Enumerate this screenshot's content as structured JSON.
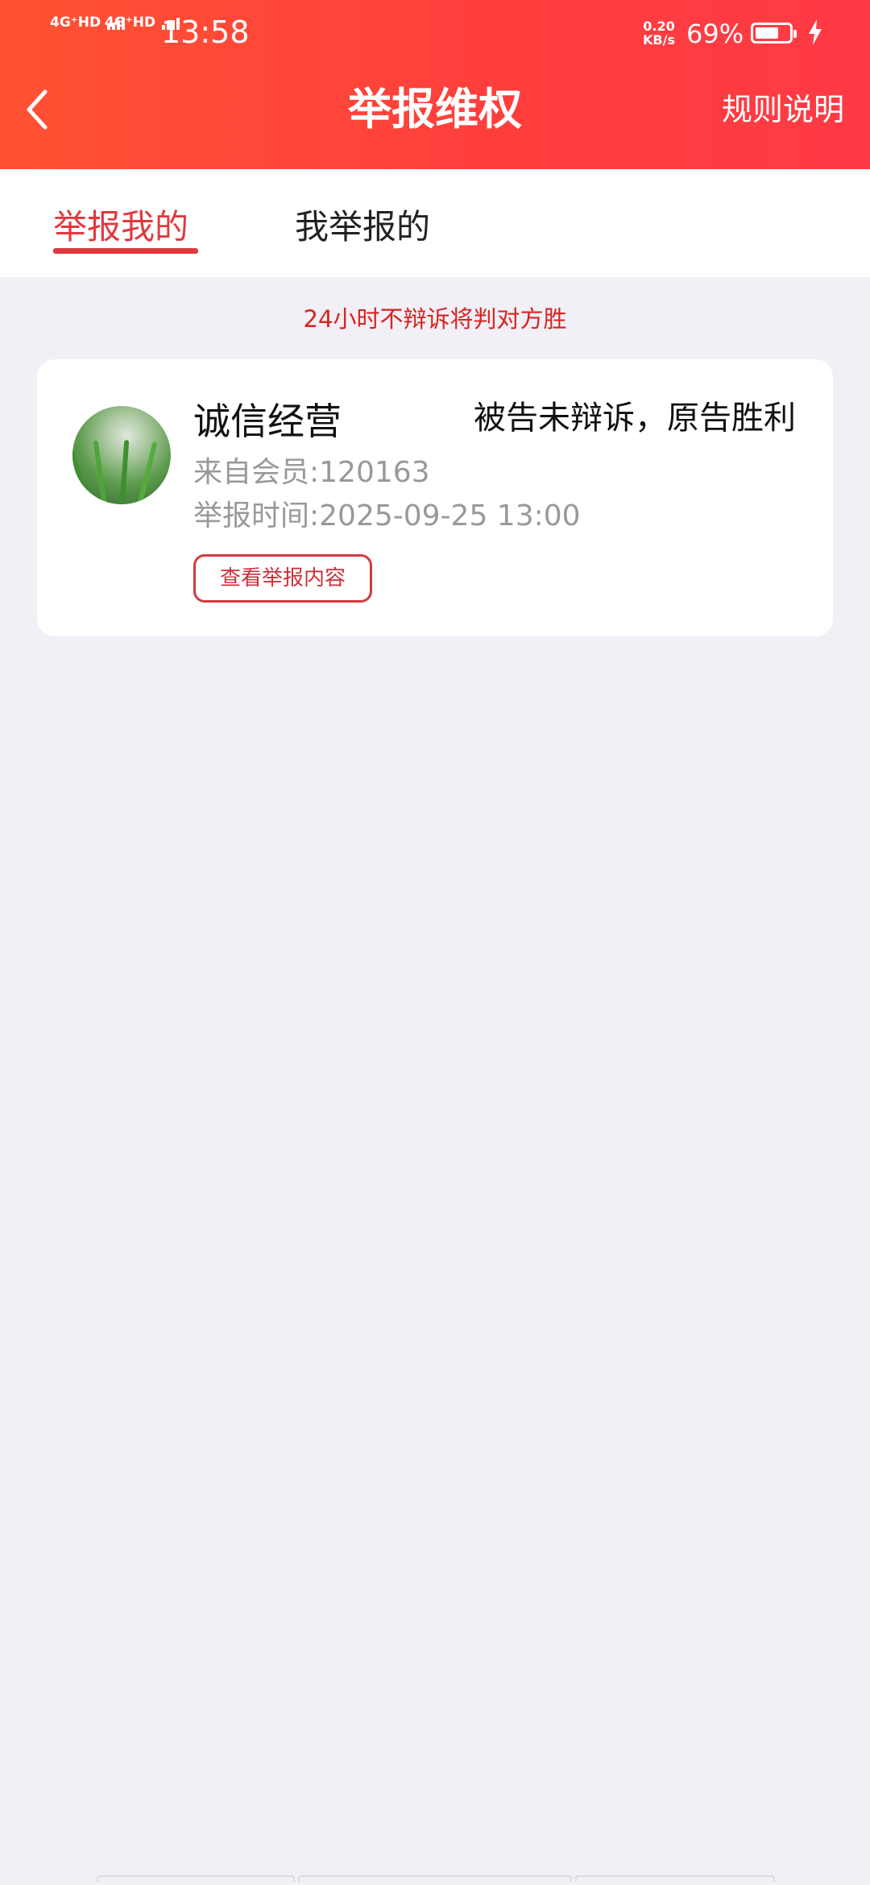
{
  "status_bar": {
    "signal_1": "4G⁺HD",
    "signal_2": "4G⁺HD",
    "time": "13:58",
    "network_speed_value": "0.20",
    "network_speed_unit": "KB/s",
    "battery_percent": "69%",
    "battery_level": 0.69,
    "charging": true
  },
  "header": {
    "title": "举报维权",
    "rules_link": "规则说明"
  },
  "tabs": [
    {
      "label": "举报我的",
      "active": true
    },
    {
      "label": "我举报的",
      "active": false
    }
  ],
  "notice": "24小时不辩诉将判对方胜",
  "report_card": {
    "name": "诚信经营",
    "status": "被告未辩诉，原告胜利",
    "from_member": "来自会员:120163",
    "report_time": "举报时间:2025-09-25  13:00",
    "view_button": "查看举报内容"
  },
  "colors": {
    "header_start": "#ff5233",
    "header_end": "#ff3a45",
    "accent": "#e0393e",
    "notice": "#d8231f",
    "background": "#f0f0f6"
  }
}
